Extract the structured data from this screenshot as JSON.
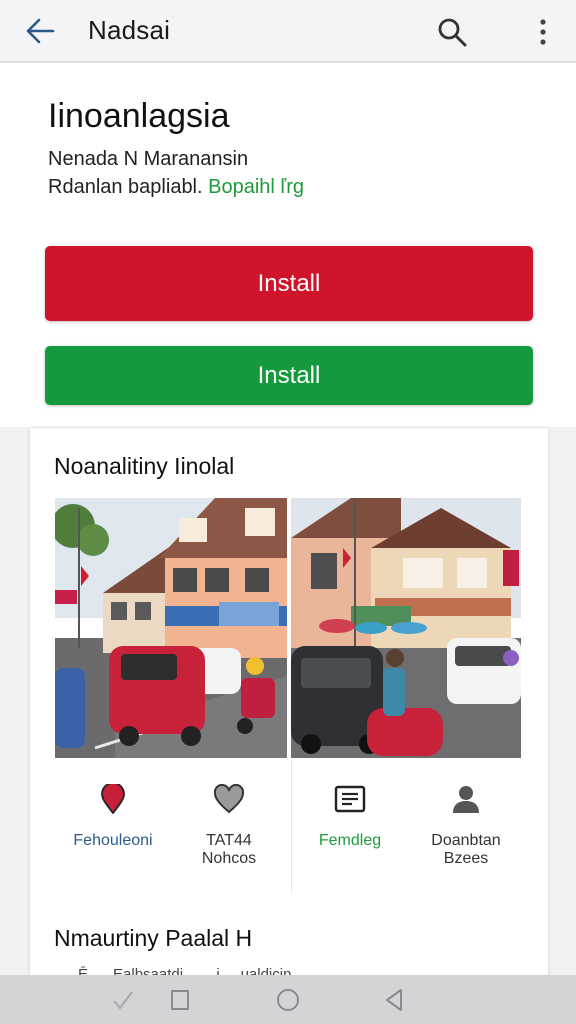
{
  "app_bar": {
    "title": "Nadsai",
    "back_icon": "arrow-left-icon",
    "search_icon": "search-icon",
    "more_icon": "more-vert-icon"
  },
  "app": {
    "name": "Iinoanlagsia",
    "developer": "Nenada N  Maranansin",
    "meta_text": "Rdanlan bapliabl.",
    "meta_link": "Bopaihl ľrg"
  },
  "buttons": {
    "install_red": "Install",
    "install_green": "Install"
  },
  "colors": {
    "red": "#d0142c",
    "green": "#149a3c",
    "link_green": "#1e9b3c",
    "label_blue": "#2c5b8e"
  },
  "section1": {
    "title": "Noanalitiny Iinolal"
  },
  "feature_icons": [
    {
      "icon": "map-pin-icon",
      "label": "Fehouleoni"
    },
    {
      "icon": "heart-icon",
      "label": "TAT44\nNohcos"
    },
    {
      "icon": "document-icon",
      "label": "Femdleg"
    },
    {
      "icon": "person-icon",
      "label": "Doanbtan\nBzees"
    }
  ],
  "section2": {
    "title": "Nmaurtiny Paalal H",
    "clipped_text": "Ē      Ealbsaatdi        i     ualdicin"
  },
  "nav_bar": {
    "icons": [
      "check-icon",
      "square-icon",
      "circle-icon",
      "triangle-back-icon"
    ]
  }
}
